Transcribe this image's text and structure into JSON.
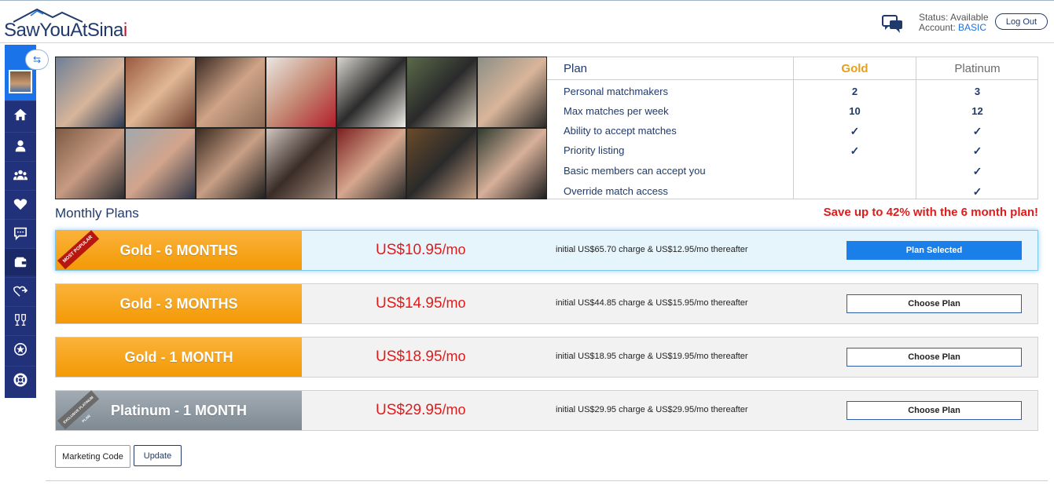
{
  "header": {
    "logo_main": "SawYouAtSina",
    "logo_accent": "i",
    "status_label": "Status:",
    "status_value": "Available",
    "account_label": "Account:",
    "account_value": "BASIC",
    "logout_label": "Log Out"
  },
  "comparison": {
    "headers": {
      "plan": "Plan",
      "gold": "Gold",
      "platinum": "Platinum"
    },
    "rows": [
      {
        "feature": "Personal matchmakers",
        "gold": "2",
        "platinum": "3"
      },
      {
        "feature": "Max matches per week",
        "gold": "10",
        "platinum": "12"
      },
      {
        "feature": "Ability to accept matches",
        "gold": "✓",
        "platinum": "✓"
      },
      {
        "feature": "Priority listing",
        "gold": "✓",
        "platinum": "✓"
      },
      {
        "feature": "Basic members can accept you",
        "gold": "",
        "platinum": "✓"
      },
      {
        "feature": "Override match access",
        "gold": "",
        "platinum": "✓"
      }
    ]
  },
  "monthly_title": "Monthly Plans",
  "save_note": "Save up to 42% with the 6 month plan!",
  "plans": [
    {
      "name": "Gold - 6 MONTHS",
      "ribbon": "MOST POPULAR",
      "price": "US$10.95",
      "per": "/mo",
      "desc": "initial US$65.70 charge & US$12.95/mo thereafter",
      "button": "Plan Selected"
    },
    {
      "name": "Gold - 3 MONTHS",
      "price": "US$14.95",
      "per": "/mo",
      "desc": "initial US$44.85 charge & US$15.95/mo thereafter",
      "button": "Choose Plan"
    },
    {
      "name": "Gold - 1 MONTH",
      "price": "US$18.95",
      "per": "/mo",
      "desc": "initial US$18.95 charge & US$19.95/mo thereafter",
      "button": "Choose Plan"
    },
    {
      "name": "Platinum - 1 MONTH",
      "ribbon": "EXCLUSIVE PLATINUM PLAN",
      "price": "US$29.95",
      "per": "/mo",
      "desc": "initial US$29.95 charge & US$29.95/mo thereafter",
      "button": "Choose Plan"
    }
  ],
  "footer": {
    "marketing_label": "Marketing Code",
    "update_label": "Update"
  },
  "colors": {
    "navy": "#1f3a6b",
    "blue": "#1a73e8",
    "gold": "#f39a05",
    "red": "#e01b1b",
    "check": "#3ca33c"
  },
  "sidebar_icons": [
    "home-icon",
    "user-icon",
    "group-icon",
    "heart-icon",
    "chat-bubble-icon",
    "wallet-icon",
    "heart-share-icon",
    "toast-icon",
    "star-circle-icon",
    "lifebuoy-icon"
  ]
}
